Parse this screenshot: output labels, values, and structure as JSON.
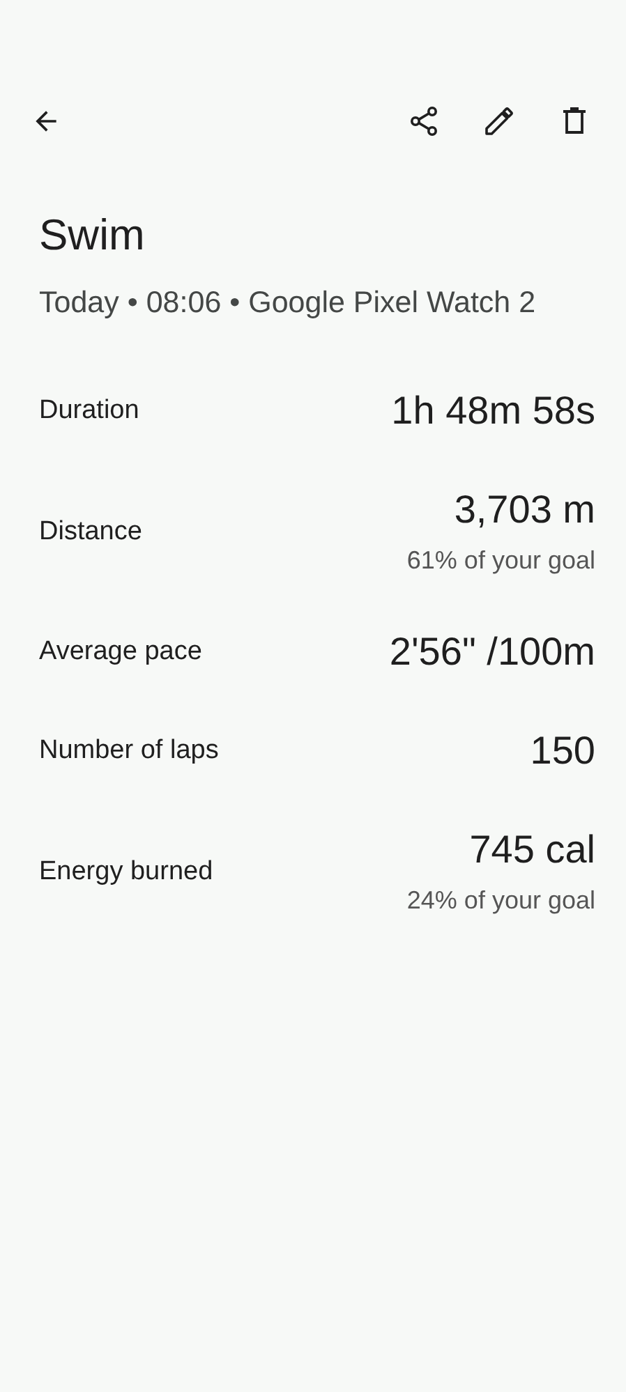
{
  "title": "Swim",
  "subtitle": "Today • 08:06 • Google Pixel Watch 2",
  "metrics": [
    {
      "label": "Duration",
      "value": "1h 48m 58s"
    },
    {
      "label": "Distance",
      "value": "3,703 m",
      "goal": "61% of your goal"
    },
    {
      "label": "Average pace",
      "value": "2'56\" /100m"
    },
    {
      "label": "Number of laps",
      "value": "150"
    },
    {
      "label": "Energy burned",
      "value": "745 cal",
      "goal": "24% of your goal"
    }
  ]
}
